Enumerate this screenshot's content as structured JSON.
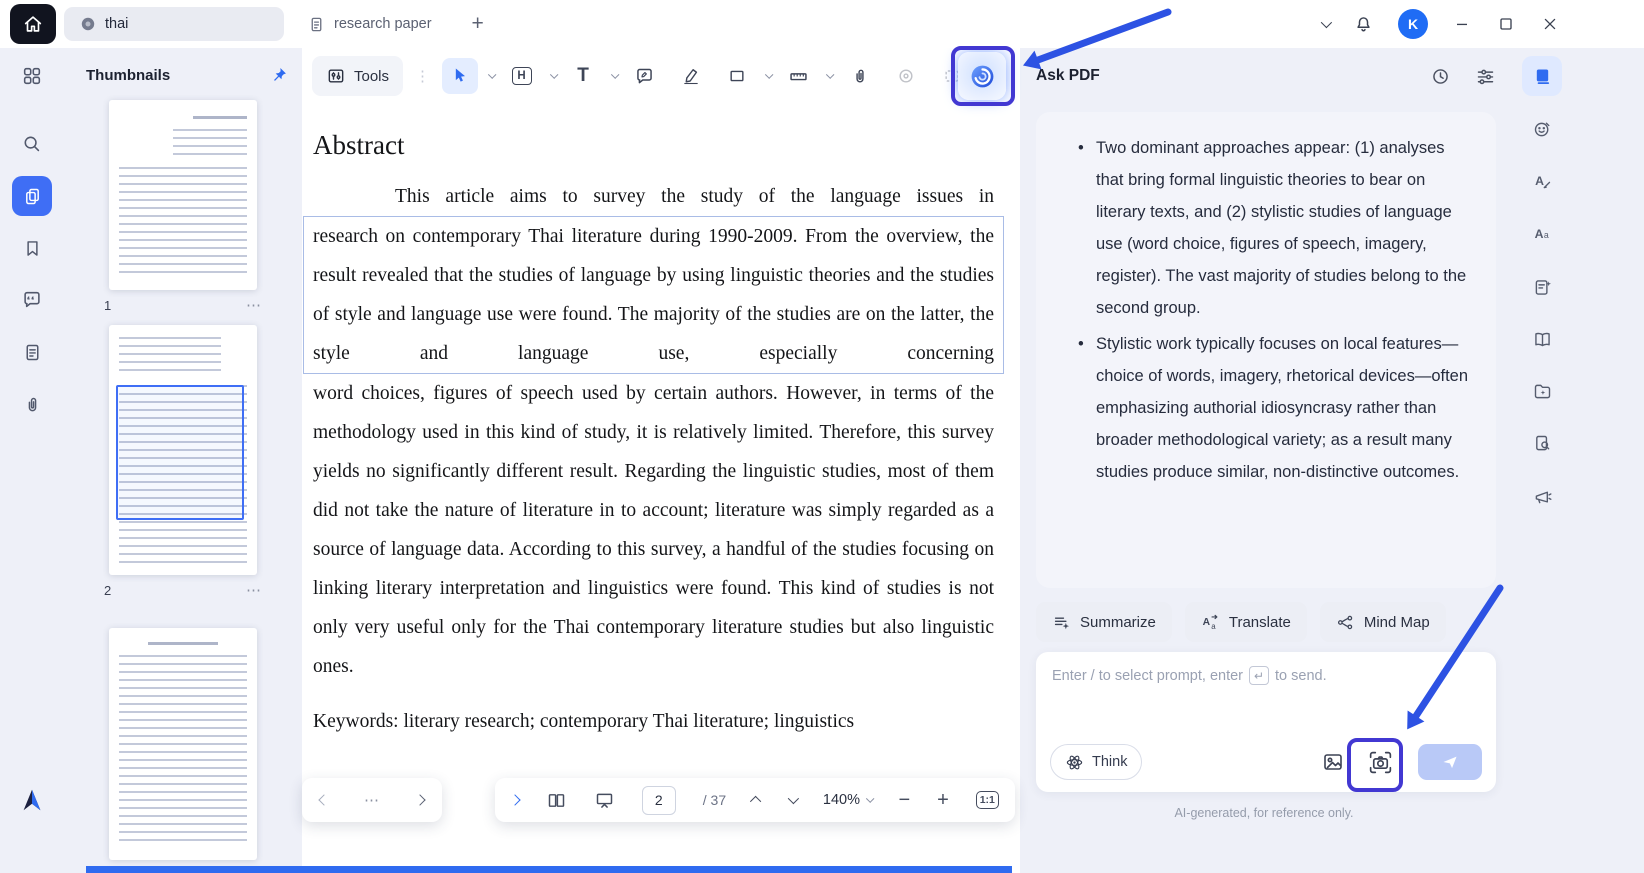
{
  "colors": {
    "accent": "#2f6bf0",
    "annotation_box": "#4238d2",
    "annotation_arrow": "#2d52e3",
    "selection_border": "#a9bce6",
    "active_icon_bg": "#3f6ef5"
  },
  "icons": {
    "plus": "+",
    "minus": "−",
    "more": "⋯",
    "divider_dots": "⋮",
    "h_tool": "H",
    "t_tool": "T",
    "enter_key": "↵"
  },
  "titlebar": {
    "tabs": [
      {
        "label": "thai"
      },
      {
        "label": "research paper"
      }
    ],
    "avatar_initial": "K"
  },
  "thumbnails_panel": {
    "title": "Thumbnails",
    "pages": [
      {
        "number": "1"
      },
      {
        "number": "2",
        "selected": true
      },
      {
        "number": ""
      }
    ]
  },
  "toolbar": {
    "tools_label": "Tools"
  },
  "document": {
    "heading": "Abstract",
    "first_line": "This article aims to survey the study of the language issues in",
    "selected_text": "research on contemporary Thai literature during 1990-2009. From the overview, the result revealed that the studies of language by using linguistic theories and the studies of style and language use were found. The majority of the studies are on the latter, the style and language use, especially concerning",
    "body_text": "word choices, figures of speech used by certain authors. However, in terms of the methodology used in this kind of study, it is relatively limited. Therefore, this survey yields no significantly different result. Regarding the linguistic studies, most of them did not take the nature of literature in to account; literature was simply regarded as a source of language data. According to this survey, a handful of the studies focusing on linking literary interpretation and linguistics were found. This kind of studies is not only very useful only for the Thai contemporary literature studies but also linguistic ones.",
    "keywords": "Keywords: literary research; contemporary Thai literature; linguistics"
  },
  "pager": {
    "current_page": "2",
    "total_pages": "/ 37",
    "zoom": "140%",
    "fit": "1:1"
  },
  "ask_pdf": {
    "title": "Ask PDF",
    "bullets": [
      "Two dominant approaches appear: (1) analyses that bring formal linguistic theories to bear on literary texts, and (2) stylistic studies of language use (word choice, figures of speech, imagery, register). The vast majority of studies belong to the second group.",
      "Stylistic work typically focuses on local features—choice of words, imagery, rhetorical devices—often emphasizing authorial idiosyncrasy rather than broader methodological variety; as a result many studies produce similar, non-distinctive outcomes."
    ],
    "actions": [
      {
        "label": "Summarize"
      },
      {
        "label": "Translate"
      },
      {
        "label": "Mind Map"
      }
    ],
    "input_placeholder_prefix": "Enter / to select prompt, enter",
    "input_placeholder_suffix": "to send.",
    "think_label": "Think",
    "disclaimer": "AI-generated, for reference only."
  }
}
